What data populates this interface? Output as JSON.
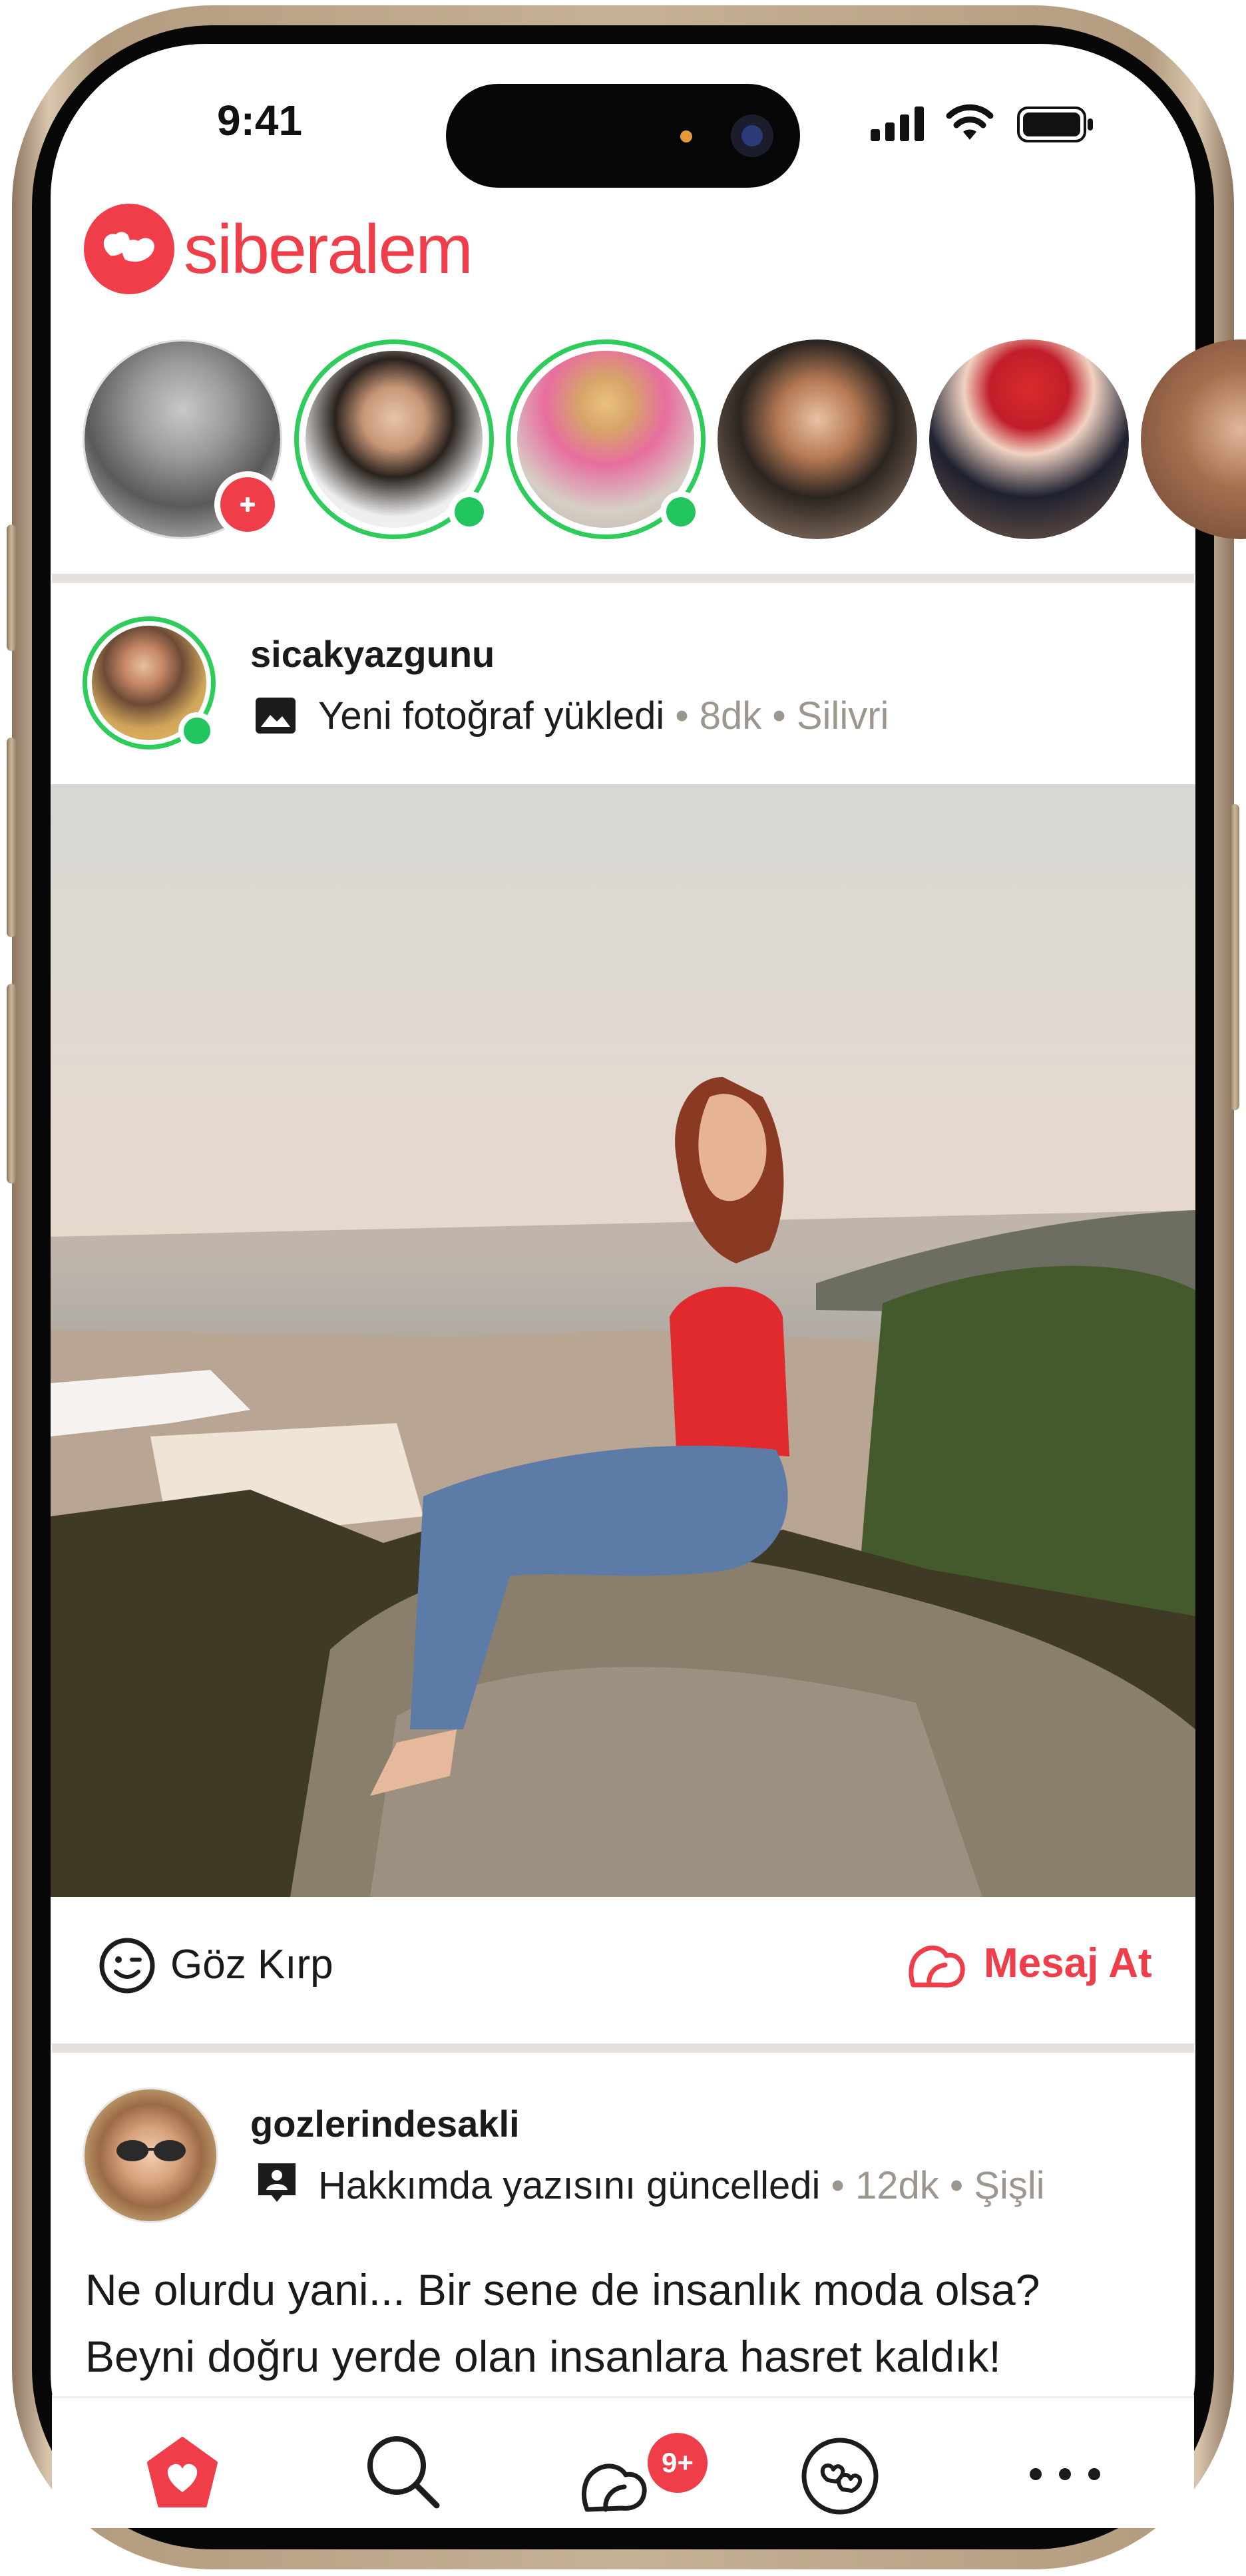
{
  "status_bar": {
    "time": "9:41"
  },
  "app": {
    "name": "siberalem",
    "brand_color": "#ef3e4a"
  },
  "stories": {
    "items": [
      {
        "kind": "add",
        "ring": false,
        "online": false
      },
      {
        "ring": true,
        "online": true
      },
      {
        "ring": true,
        "online": true
      },
      {
        "ring": false,
        "online": false
      },
      {
        "ring": false,
        "online": false
      },
      {
        "ring": false,
        "online": false
      }
    ],
    "ring_color": "#2ecc5a"
  },
  "posts": [
    {
      "username": "sicakyazgunu",
      "activity_icon": "image-icon",
      "activity": "Yeni fotoğraf yükledi",
      "time_ago": "8dk",
      "location": "Silivri",
      "online": true,
      "actions": {
        "wink": "Göz Kırp",
        "message": "Mesaj At"
      }
    },
    {
      "username": "gozlerindesakli",
      "activity_icon": "profile-card-icon",
      "activity": "Hakkımda yazısını güncelledi",
      "time_ago": "12dk",
      "location": "Şişli",
      "text_lines": [
        "Ne olurdu yani... Bir sene de insanlık moda olsa?",
        "Beyni doğru yerde olan insanlara hasret kaldık!"
      ]
    }
  ],
  "separator": "•",
  "tab_bar": {
    "items": [
      {
        "name": "home",
        "icon": "heart-shield-icon",
        "active": true
      },
      {
        "name": "search",
        "icon": "search-icon"
      },
      {
        "name": "messages",
        "icon": "chat-bubbles-icon",
        "badge": "9+"
      },
      {
        "name": "matches",
        "icon": "linked-hearts-icon"
      },
      {
        "name": "more",
        "icon": "more-dots-icon"
      }
    ]
  }
}
